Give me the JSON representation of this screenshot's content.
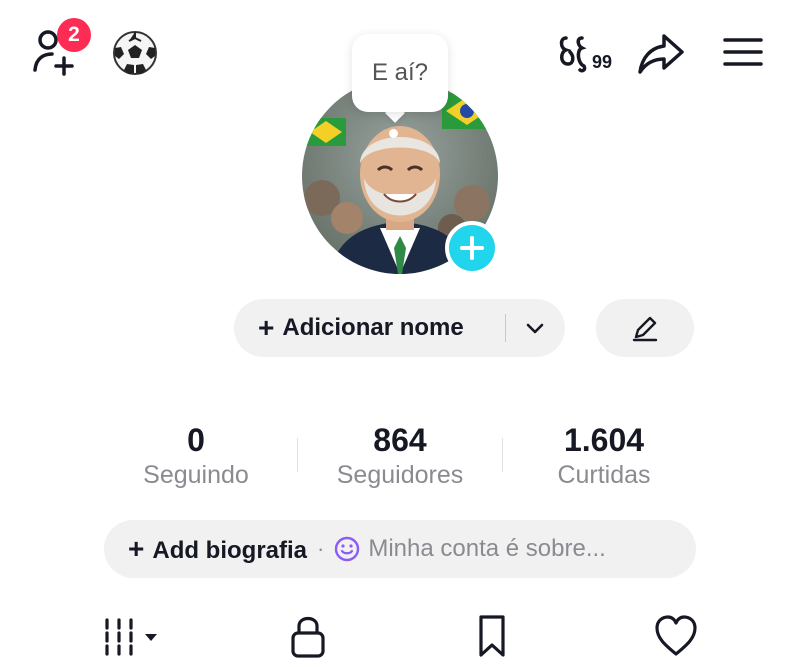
{
  "header": {
    "friend_badge_count": "2",
    "speech_bubble_text": "E aí?"
  },
  "profile": {
    "add_name_label": "Adicionar nome"
  },
  "stats": [
    {
      "value": "0",
      "label": "Seguindo"
    },
    {
      "value": "864",
      "label": "Seguidores"
    },
    {
      "value": "1.604",
      "label": "Curtidas"
    }
  ],
  "bio": {
    "add_label": "Add biografia",
    "separator": "·",
    "placeholder": "Minha conta é sobre..."
  },
  "colors": {
    "badge": "#fe2c55",
    "add_avatar": "#20d5ec",
    "pill_background": "#f1f1f2",
    "muted_text": "#8a8b91"
  },
  "icons": [
    "add-friend-icon",
    "soccer-ball-icon",
    "activity-icon",
    "share-icon",
    "menu-icon",
    "plus-icon",
    "chevron-down-icon",
    "pencil-icon",
    "smiley-icon",
    "videos-grid-icon",
    "lock-icon",
    "bookmark-icon",
    "heart-icon"
  ]
}
